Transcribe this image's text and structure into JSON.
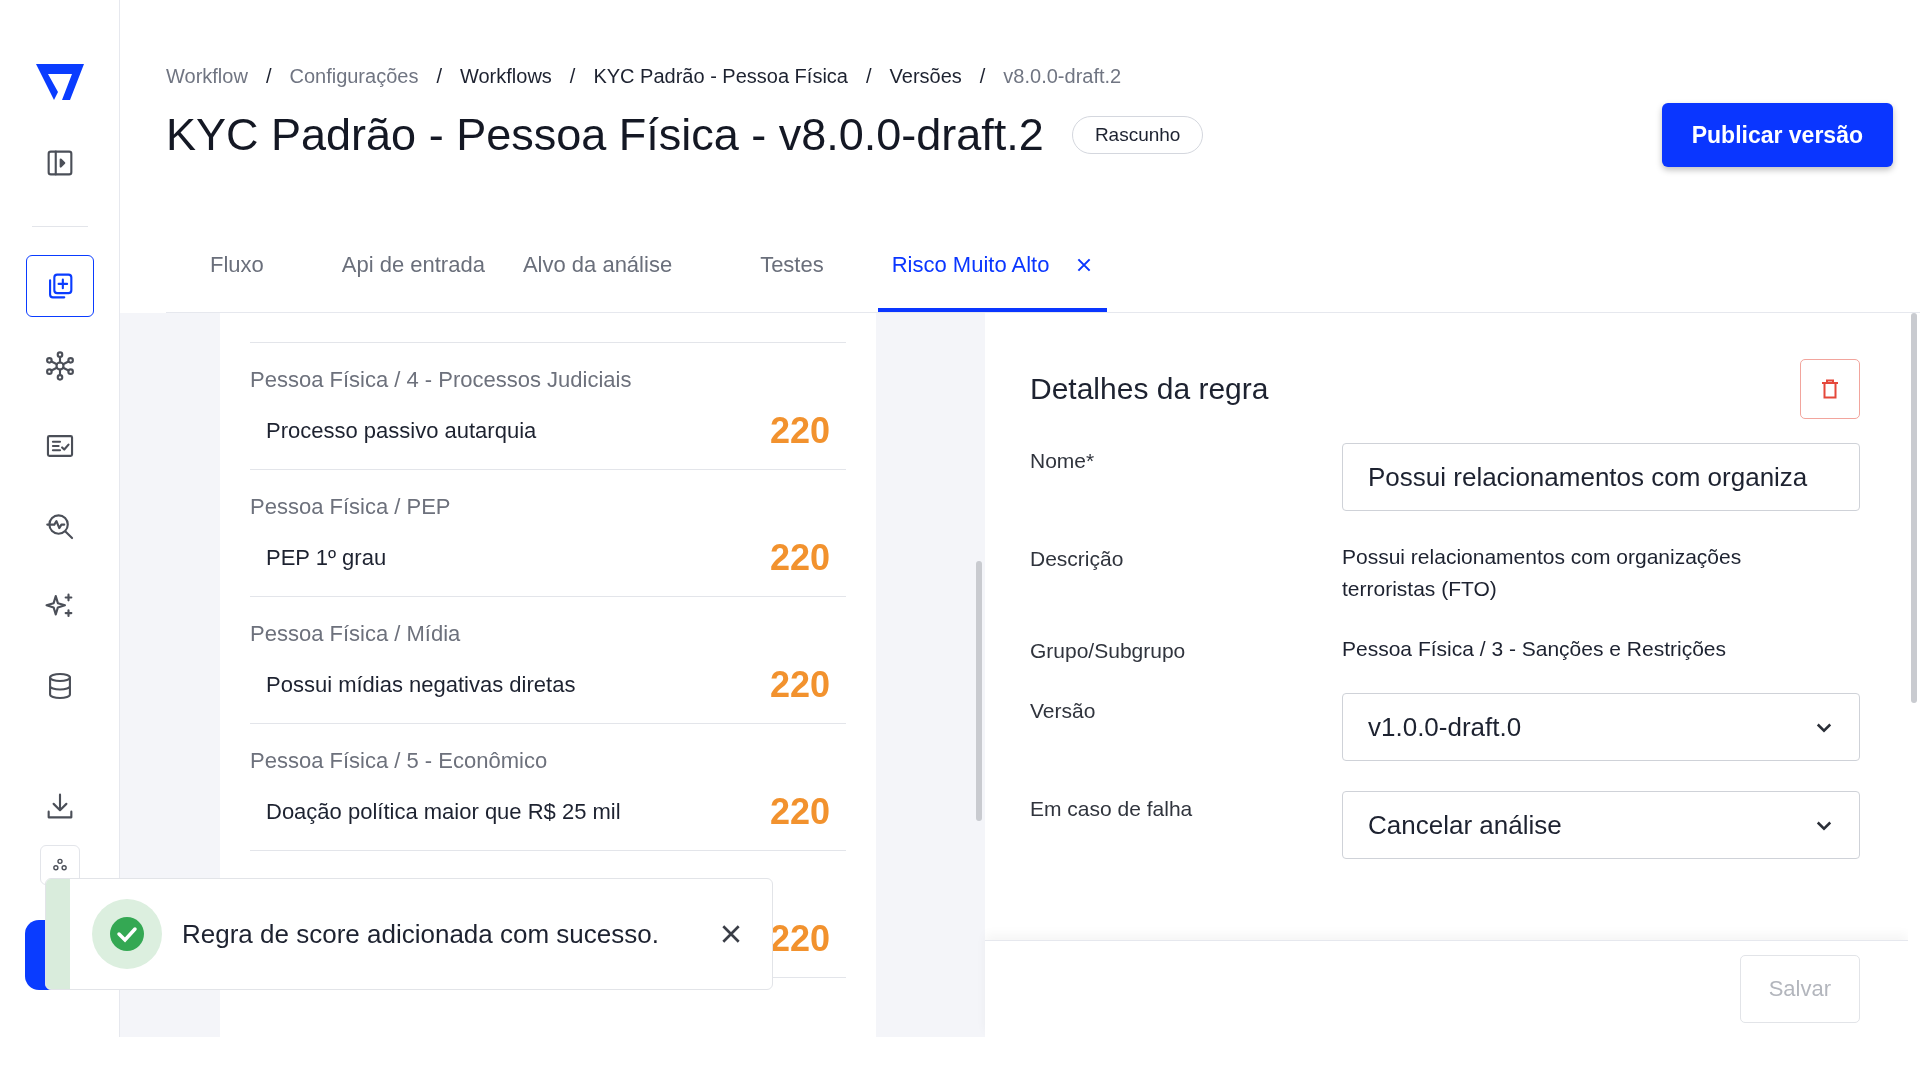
{
  "sidebar": {
    "items": [
      {
        "kind": "panel",
        "selected": false
      },
      {
        "kind": "add-document",
        "selected": true
      },
      {
        "kind": "network",
        "selected": false
      },
      {
        "kind": "checklist",
        "selected": false
      },
      {
        "kind": "search-pulse",
        "selected": false
      },
      {
        "kind": "sparkles",
        "selected": false
      },
      {
        "kind": "database",
        "selected": false
      },
      {
        "kind": "download",
        "selected": false
      },
      {
        "kind": "cluster",
        "selected": false
      }
    ]
  },
  "breadcrumbs": [
    {
      "label": "Workflow",
      "muted": true
    },
    {
      "separator": "/",
      "label": "Configurações",
      "muted": true
    },
    {
      "separator": "/",
      "label": "Workflows",
      "muted": false
    },
    {
      "separator": "/",
      "label": "KYC Padrão - Pessoa Física",
      "muted": false
    },
    {
      "separator": "/",
      "label": "Versões",
      "muted": false
    },
    {
      "separator": "/",
      "label": "v8.0.0-draft.2",
      "muted": true
    }
  ],
  "title": "KYC Padrão - Pessoa Física - v8.0.0-draft.2",
  "status_badge": "Rascunho",
  "publish_button": "Publicar versão",
  "tabs": [
    {
      "label": "Fluxo",
      "selected": false,
      "closable": false
    },
    {
      "label": "Api de entrada",
      "selected": false,
      "closable": false
    },
    {
      "label": "Alvo da análise",
      "selected": false,
      "closable": false
    },
    {
      "label": "Testes",
      "selected": false,
      "closable": false
    },
    {
      "label": "Risco Muito Alto",
      "selected": true,
      "closable": true
    }
  ],
  "rules": [
    {
      "group": "Pessoa Física / 4 - Processos Judiciais",
      "name": "Processo passivo autarquia",
      "score": "220"
    },
    {
      "group": "Pessoa Física / PEP",
      "name": "PEP 1º grau",
      "score": "220"
    },
    {
      "group": "Pessoa Física / Mídia",
      "name": "Possui mídias negativas diretas",
      "score": "220"
    },
    {
      "group": "Pessoa Física / 5 - Econômico",
      "name": "Doação política maior que R$ 25 mil",
      "score": "220"
    },
    {
      "score": "220"
    }
  ],
  "details": {
    "title": "Detalhes da regra",
    "fields": [
      {
        "kind": "input",
        "label": "Nome*",
        "value": "Possui relacionamentos com organiza"
      },
      {
        "kind": "text",
        "label": "Descrição",
        "value": "Possui relacionamentos com organizações terroristas (FTO)"
      },
      {
        "kind": "text",
        "label": "Grupo/Subgrupo",
        "value": "Pessoa Física / 3 - Sanções e Restrições"
      },
      {
        "kind": "select",
        "label": "Versão",
        "value": "v1.0.0-draft.0"
      },
      {
        "kind": "select",
        "label": "Em caso de falha",
        "value": "Cancelar análise"
      }
    ],
    "save_button": {
      "label": "Salvar",
      "disabled": true
    }
  },
  "toast": {
    "message": "Regra de score adicionada com sucesso."
  }
}
